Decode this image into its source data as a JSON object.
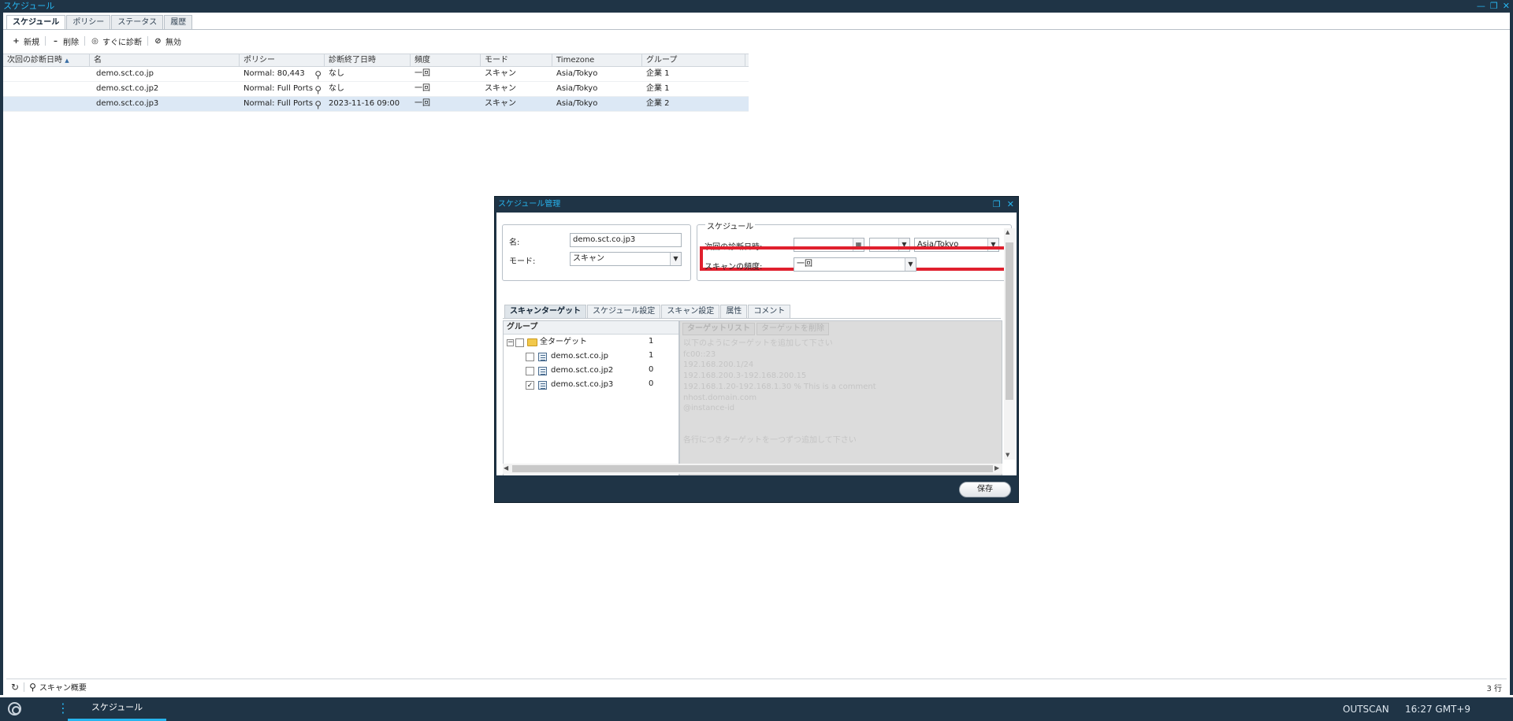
{
  "window": {
    "title": "スケジュール"
  },
  "tabs": [
    "スケジュール",
    "ポリシー",
    "ステータス",
    "履歴"
  ],
  "toolbar": {
    "new_label": "新規",
    "delete_label": "削除",
    "scan_now_label": "すぐに診断",
    "disable_label": "無効"
  },
  "grid": {
    "columns": [
      "次回の診断日時",
      "名",
      "ポリシー",
      "診断終了日時",
      "頻度",
      "モード",
      "Timezone",
      "グループ"
    ],
    "sort_indicator": "▲",
    "rows": [
      [
        "",
        "demo.sct.co.jp",
        "Normal: 80,443",
        "なし",
        "一回",
        "スキャン",
        "Asia/Tokyo",
        "企業 1"
      ],
      [
        "",
        "demo.sct.co.jp2",
        "Normal: Full Ports",
        "なし",
        "一回",
        "スキャン",
        "Asia/Tokyo",
        "企業 1"
      ],
      [
        "",
        "demo.sct.co.jp3",
        "Normal: Full Ports",
        "2023-11-16 09:00",
        "一回",
        "スキャン",
        "Asia/Tokyo",
        "企業 2"
      ]
    ],
    "selected_row": 2
  },
  "statusbar": {
    "summary_label": "スキャン概要",
    "row_count": "3 行"
  },
  "taskbar": {
    "task_label": "スケジュール",
    "brand": "OUTSCAN",
    "time": "16:27 GMT+9"
  },
  "dialog": {
    "title": "スケジュール管理",
    "name_label": "名:",
    "name_value": "demo.sct.co.jp3",
    "mode_label": "モード:",
    "mode_value": "スキャン",
    "schedule_legend": "スケジュール",
    "next_scan_label": "次回の診断日時:",
    "next_scan_date": "",
    "next_scan_time": "",
    "timezone_value": "Asia/Tokyo",
    "frequency_label": "スキャンの頻度:",
    "frequency_value": "一回",
    "inner_tabs": [
      "スキャンターゲット",
      "スケジュール設定",
      "スキャン設定",
      "属性",
      "コメント"
    ],
    "group_header": "グループ",
    "tree": [
      {
        "label": "全ターゲット",
        "count": "1",
        "checked": false
      },
      {
        "label": "demo.sct.co.jp",
        "count": "1",
        "checked": false
      },
      {
        "label": "demo.sct.co.jp2",
        "count": "0",
        "checked": false
      },
      {
        "label": "demo.sct.co.jp3",
        "count": "0",
        "checked": true
      }
    ],
    "target_tabs": [
      "ターゲットリスト",
      "ターゲットを削除"
    ],
    "target_hint_lines": [
      "以下のようにターゲットを追加して下さい",
      "fc00::23",
      "192.168.200.1/24",
      "192.168.200.3-192.168.200.15",
      "192.168.1.20-192.168.1.30 % This is a comment",
      "nhost.domain.com",
      "@instance-id",
      "",
      "各行につきターゲットを一つずつ追加して下さい"
    ],
    "save_label": "保存"
  },
  "colors": {
    "frame": "#1f3446",
    "accent": "#27b5ef",
    "highlight": "#e0202e",
    "selected_row": "#dce8f5"
  }
}
